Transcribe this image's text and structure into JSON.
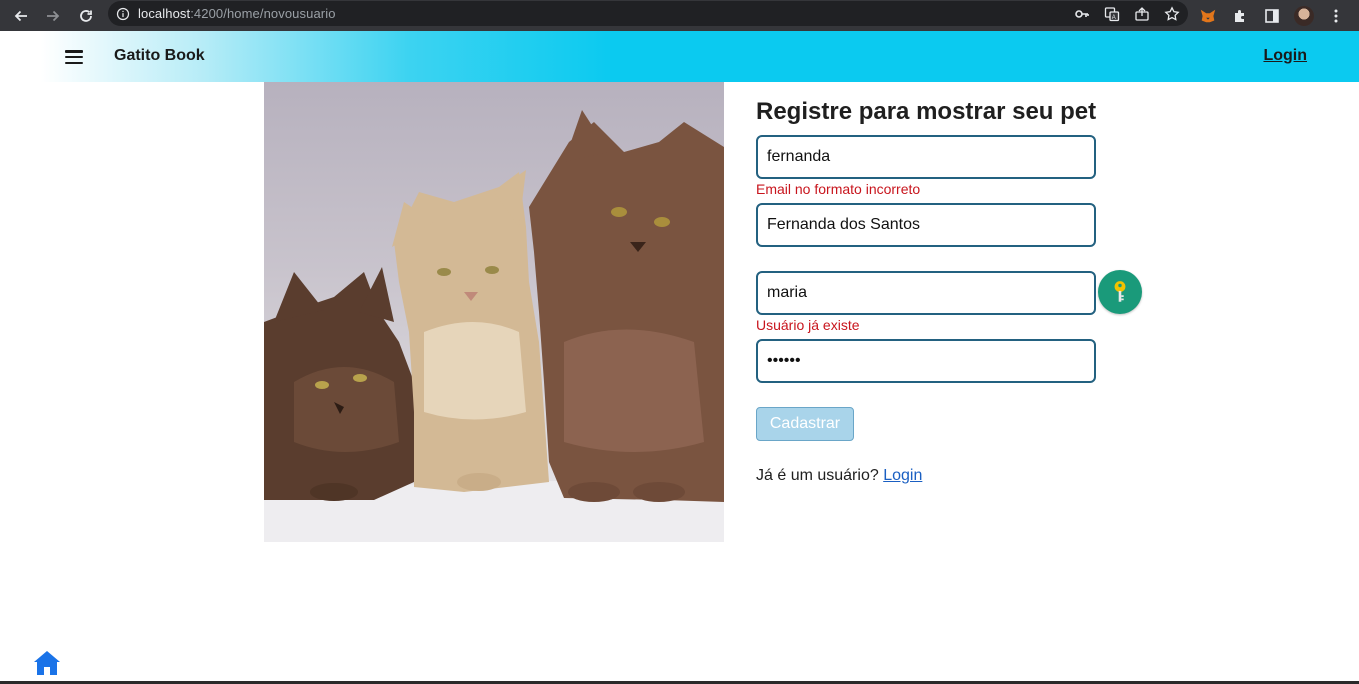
{
  "browser": {
    "url_host": "localhost",
    "url_rest": ":4200/home/novousuario"
  },
  "appbar": {
    "brand": "Gatito Book",
    "login_label": "Login"
  },
  "hero": {
    "icon": "cats-photo"
  },
  "form": {
    "title": "Registre para mostrar seu pet",
    "email_value": "fernanda",
    "email_error": "Email no formato incorreto",
    "fullname_value": "Fernanda dos Santos",
    "username_value": "maria",
    "username_error": "Usuário já existe",
    "password_value": "••••••",
    "submit_label": "Cadastrar",
    "already_text": "Já é um usuário?",
    "already_link": "Login"
  },
  "colors": {
    "appbar_accent": "#0bcaf0",
    "field_border": "#236180",
    "error": "#c8151d",
    "key_button": "#1a9a7a",
    "submit_disabled": "#a9d4ea",
    "link": "#1a5fc2",
    "home_icon": "#1a73e8"
  }
}
